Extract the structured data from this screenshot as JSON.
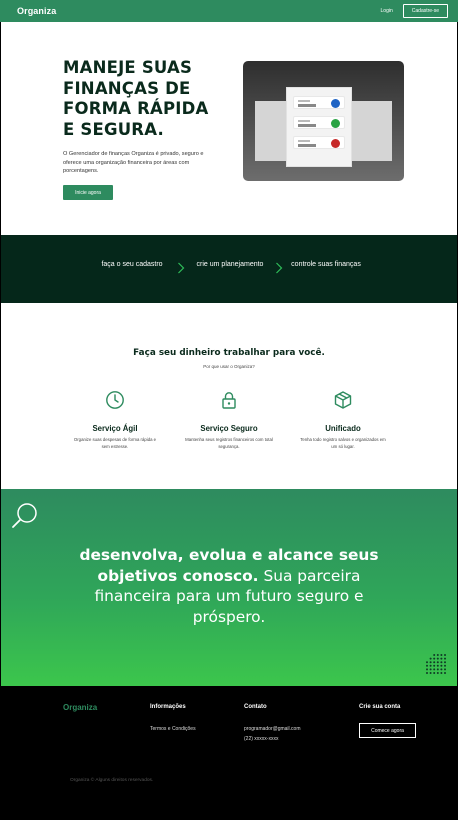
{
  "header": {
    "logo": "Organiza",
    "login_label": "Login",
    "signup_label": "Cadastre-se"
  },
  "hero": {
    "title": "MANEJE SUAS FINANÇAS DE FORMA RÁPIDA E SEGURA.",
    "description": "O Gerenciador de finanças Organiza é privado, seguro e oferece uma organização financeira por áreas com porcentagens.",
    "cta_label": "Inicie agora",
    "mockup_dot_colors": [
      "#1e63c4",
      "#2aa344",
      "#c62828"
    ]
  },
  "steps": {
    "items": [
      "faça o seu cadastro",
      "crie um planejamento",
      "controle suas finanças"
    ],
    "arrow_icon": "chevron-right-icon",
    "arrow_color": "#2fbf5a"
  },
  "features": {
    "title": "Faça seu dinheiro trabalhar para você.",
    "subtitle": "Por que usar o Organiza?",
    "icon_color": "#2e8b5f",
    "items": [
      {
        "icon": "clock-icon",
        "name": "Serviço Ágil",
        "desc": "Organize suas despesas de forma rápida e sem estresse."
      },
      {
        "icon": "lock-icon",
        "name": "Serviço Seguro",
        "desc": "Mantenha seus registros financeiros com total segurança."
      },
      {
        "icon": "box-icon",
        "name": "Unificado",
        "desc": "Tenha todo registro salvos e organizados em um só lugar."
      }
    ]
  },
  "cta": {
    "bold_text": "desenvolva, evolua e alcance seus objetivos conosco.",
    "regular_text": "Sua parceira financeira para um futuro seguro e próspero."
  },
  "footer": {
    "logo": "Organiza",
    "info_title": "Informações",
    "info_link": "Termos e Condições",
    "contact_title": "Contato",
    "contact_email": "programador@gmail.com",
    "contact_phone": "(22) xxxxx-xxxx",
    "signup_title": "Crie sua conta",
    "signup_button": "Comece agora",
    "copyright": "Organiza © Alguns direitos reservados."
  }
}
